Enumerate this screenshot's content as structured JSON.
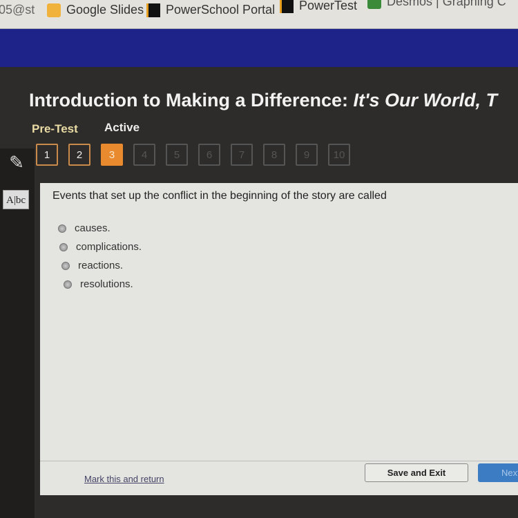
{
  "bookmarks": [
    {
      "label": "05@st",
      "icon": "none"
    },
    {
      "label": "Google Slides",
      "icon": "google-slides-icon"
    },
    {
      "label": "PowerSchool Portal",
      "icon": "powerschool-icon"
    },
    {
      "label": "PowerTest",
      "icon": "powerschool-icon"
    },
    {
      "label": "Desmos | Graphing C",
      "icon": "desmos-icon"
    }
  ],
  "header": {
    "title_main": "Introduction to Making a Difference: ",
    "title_italic": "It's Our World, T",
    "mode": "Pre-Test",
    "status": "Active"
  },
  "question_nav": {
    "current": 3,
    "items": [
      "1",
      "2",
      "3",
      "4",
      "5",
      "6",
      "7",
      "8",
      "9",
      "10"
    ]
  },
  "question": {
    "text": "Events that set up the conflict in the beginning of the story are called",
    "options": [
      "causes.",
      "complications.",
      "reactions.",
      "resolutions."
    ]
  },
  "footer": {
    "mark_label": "Mark this and return",
    "save_label": "Save and Exit",
    "next_label": "Next"
  },
  "colors": {
    "accent": "#ea8a2e",
    "banner": "#1d2388",
    "next": "#3b7cc2"
  }
}
